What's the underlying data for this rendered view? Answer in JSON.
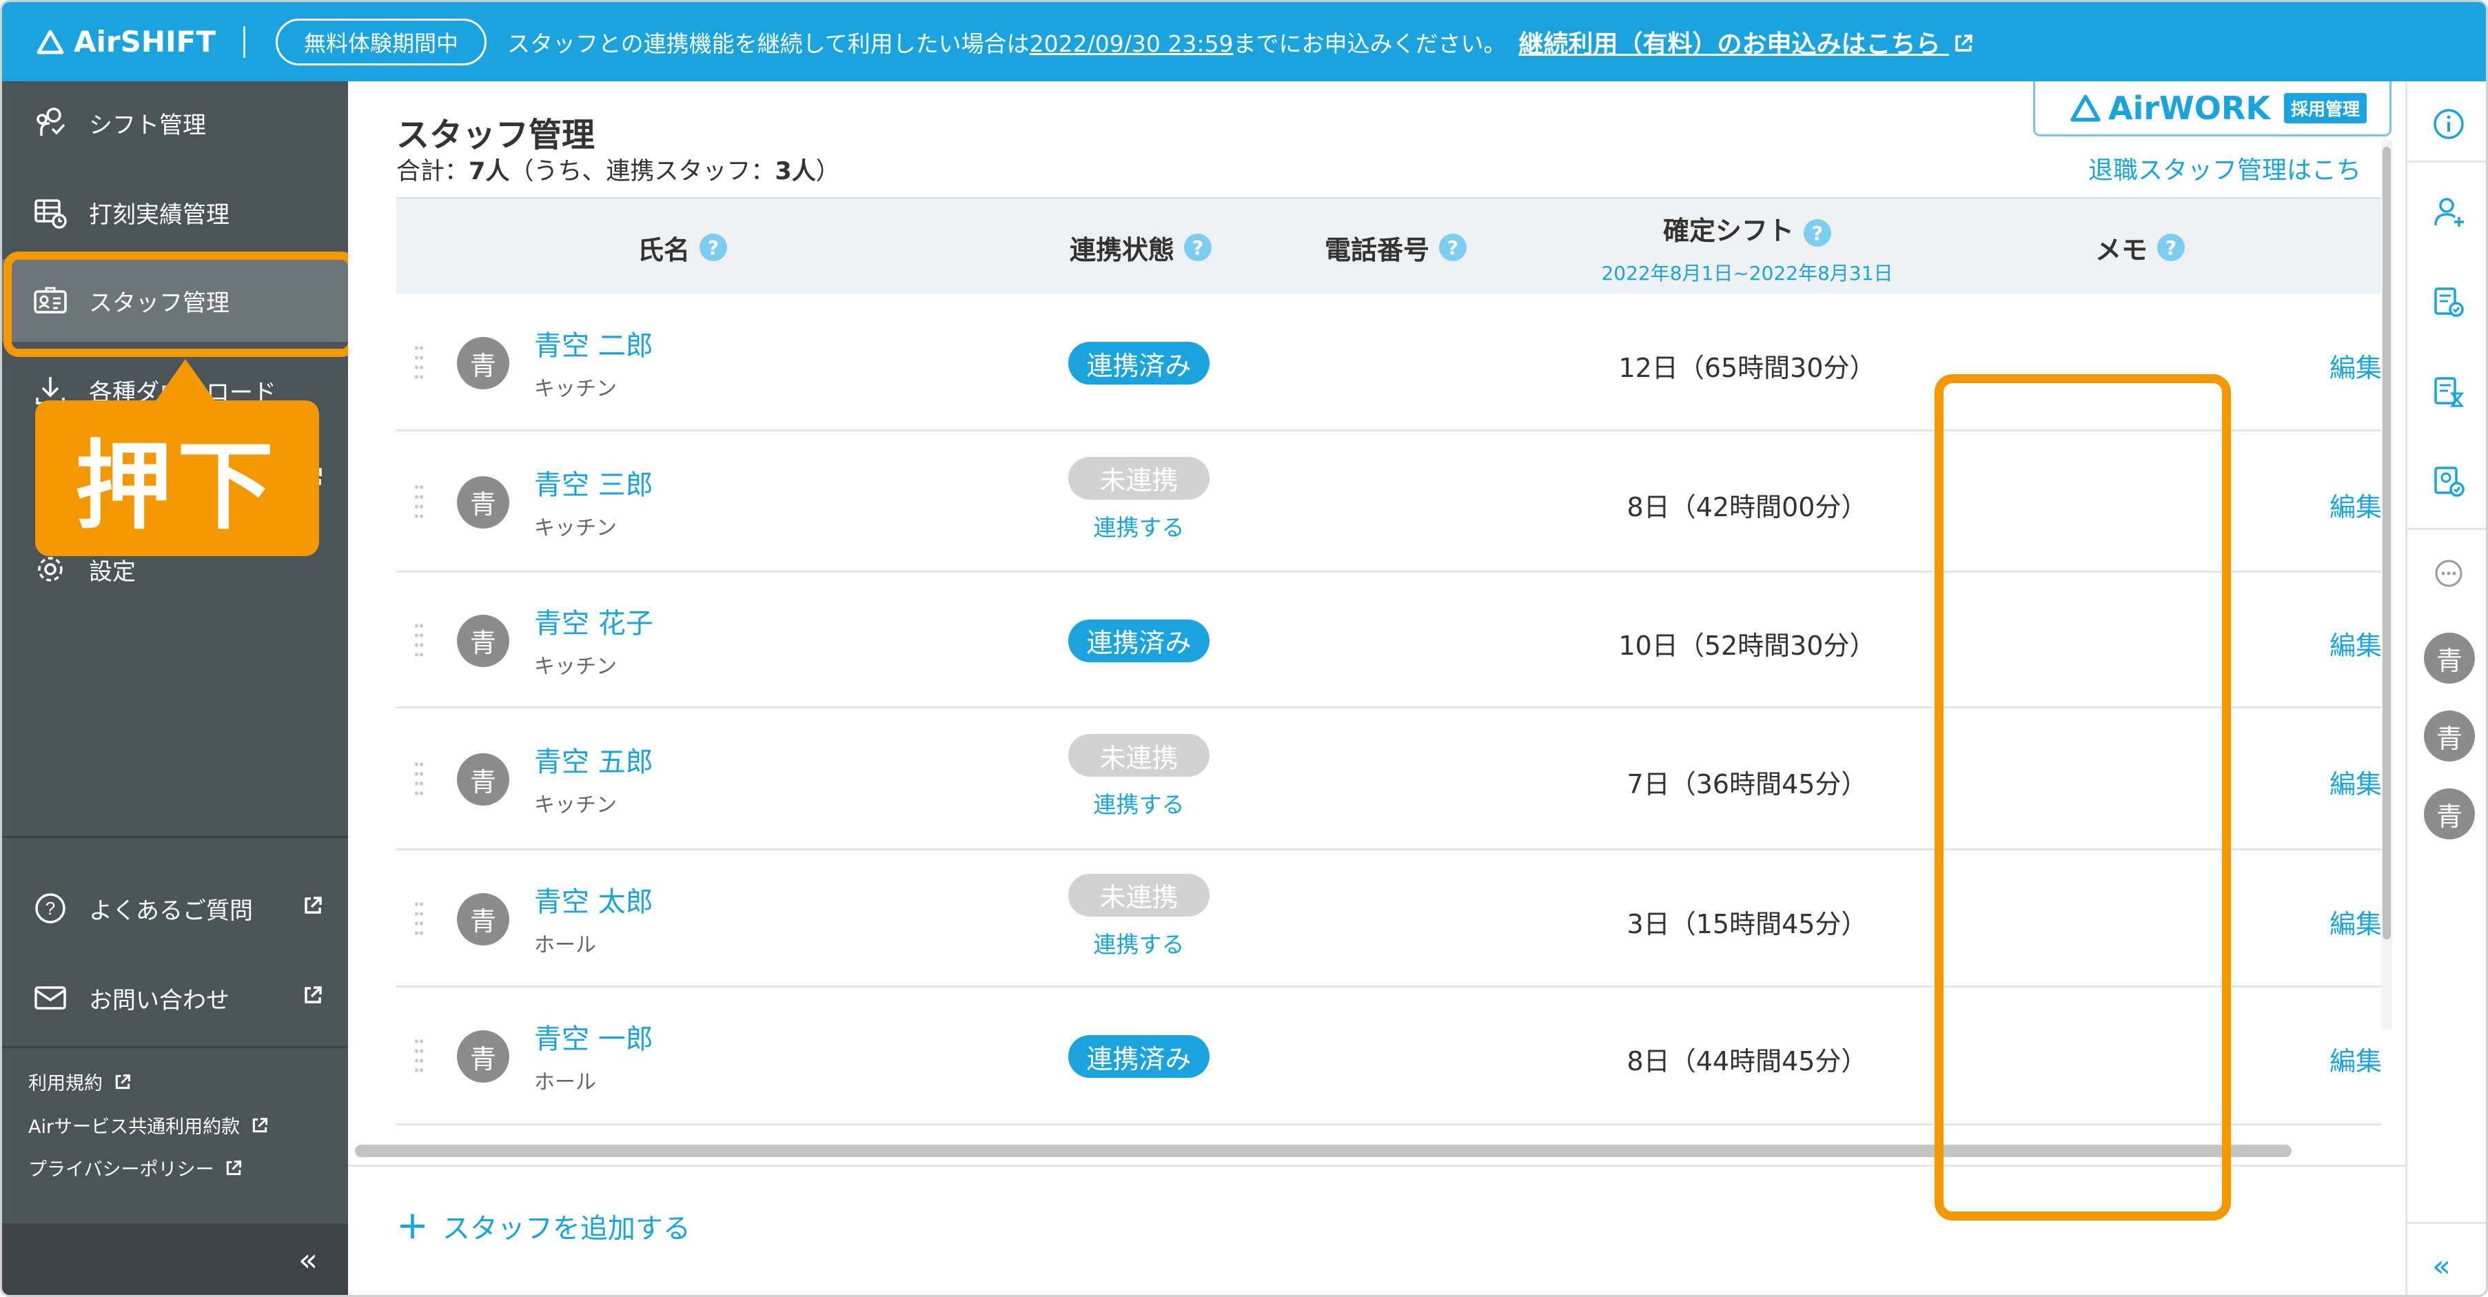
{
  "topbar": {
    "logo": "AirSHIFT",
    "trial_badge": "無料体験期間中",
    "message_pre": "スタッフとの連携機能を継続して利用したい場合は",
    "message_date": "2022/09/30 23:59",
    "message_post": "までにお申込みください。",
    "cta": "継続利用（有料）のお申込みはこちら"
  },
  "sidebar": {
    "items": [
      {
        "label": "シフト管理",
        "icon": "shift-icon"
      },
      {
        "label": "打刻実績管理",
        "icon": "timecard-icon"
      },
      {
        "label": "スタッフ管理",
        "icon": "staff-card-icon"
      },
      {
        "label": "各種ダウンロード",
        "icon": "download-icon"
      },
      {
        "label": "設定",
        "icon": "gear-icon"
      }
    ],
    "help": [
      {
        "label": "よくあるご質問",
        "icon": "question-icon"
      },
      {
        "label": "お問い合わせ",
        "icon": "mail-icon"
      }
    ],
    "footer_links": [
      "利用規約",
      "Airサービス共通利用約款",
      "プライバシーポリシー"
    ],
    "collapse": "«"
  },
  "callout": {
    "label": "押下"
  },
  "main": {
    "title": "スタッフ管理",
    "total_label": "合計：",
    "total_value": "7人",
    "total_suffix": "（うち、連携スタッフ：",
    "linked_value": "3人",
    "total_close": "）",
    "airwork_logo": "AirWORK",
    "airwork_tag": "採用管理",
    "retired_link": "退職スタッフ管理はこち",
    "columns": {
      "name": "氏名",
      "status": "連携状態",
      "phone": "電話番号",
      "shift": "確定シフト",
      "shift_period": "2022年8月1日~2022年8月31日",
      "memo": "メモ"
    },
    "rows": [
      {
        "avatar": "青",
        "name": "青空 二郎",
        "dept": "キッチン",
        "status": "連携済み",
        "action": "",
        "shift": "12日（65時間30分）",
        "edit": "編集"
      },
      {
        "avatar": "青",
        "name": "青空 三郎",
        "dept": "キッチン",
        "status": "未連携",
        "action": "連携する",
        "shift": "8日（42時間00分）",
        "edit": "編集"
      },
      {
        "avatar": "青",
        "name": "青空 花子",
        "dept": "キッチン",
        "status": "連携済み",
        "action": "",
        "shift": "10日（52時間30分）",
        "edit": "編集"
      },
      {
        "avatar": "青",
        "name": "青空 五郎",
        "dept": "キッチン",
        "status": "未連携",
        "action": "連携する",
        "shift": "7日（36時間45分）",
        "edit": "編集"
      },
      {
        "avatar": "青",
        "name": "青空 太郎",
        "dept": "ホール",
        "status": "未連携",
        "action": "連携する",
        "shift": "3日（15時間45分）",
        "edit": "編集"
      },
      {
        "avatar": "青",
        "name": "青空 一郎",
        "dept": "ホール",
        "status": "連携済み",
        "action": "",
        "shift": "8日（44時間45分）",
        "edit": "編集"
      }
    ],
    "add_staff": "スタッフを追加する",
    "help_mark": "?"
  },
  "rail": {
    "avatars": [
      "青",
      "青",
      "青"
    ],
    "collapse": "«"
  },
  "colors": {
    "brand": "#1aa3dd",
    "highlight": "#f39800",
    "sidebar": "#4a5459"
  }
}
